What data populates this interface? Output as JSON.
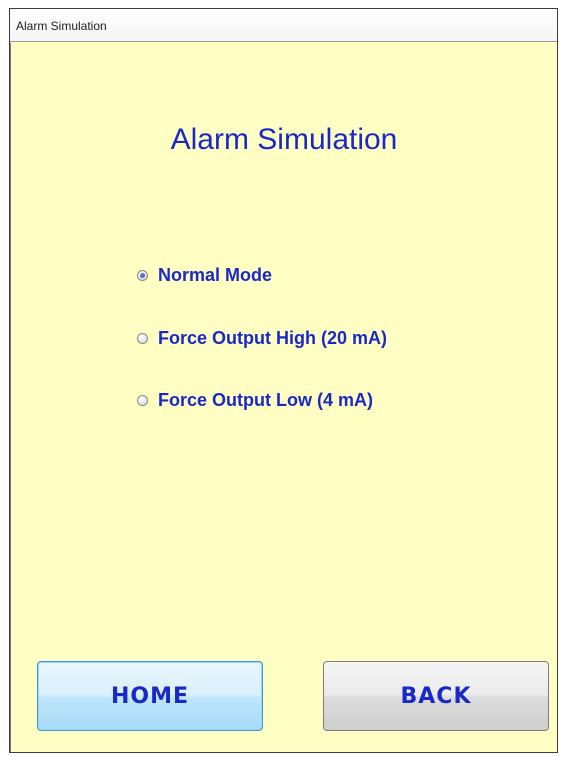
{
  "window": {
    "title": "Alarm Simulation"
  },
  "page": {
    "heading": "Alarm Simulation"
  },
  "mode_options": [
    {
      "label": "Normal Mode",
      "selected": true
    },
    {
      "label": "Force Output High (20 mA)",
      "selected": false
    },
    {
      "label": "Force Output Low (4 mA)",
      "selected": false
    }
  ],
  "buttons": {
    "home_label": "HOME",
    "back_label": "BACK"
  },
  "colors": {
    "background": "#ffffc4",
    "text_accent": "#1a28c8"
  }
}
